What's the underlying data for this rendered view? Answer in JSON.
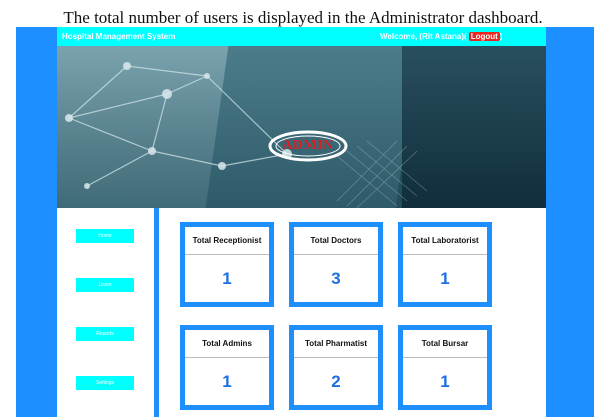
{
  "caption": "The total number of users is displayed in the Administrator dashboard.",
  "header": {
    "brand": "Hospital Management System",
    "welcome": "Welcome, (Rit Astana)(",
    "logout": "Logout",
    "welcome_end": ")"
  },
  "banner": {
    "logo_text": "ADMIN"
  },
  "sidebar": {
    "items": [
      {
        "label": "Home"
      },
      {
        "label": "Users"
      },
      {
        "label": "Reports"
      },
      {
        "label": "Settings"
      }
    ]
  },
  "dashboard": {
    "cards": [
      {
        "title": "Total Receptionist",
        "value": "1"
      },
      {
        "title": "Total Doctors",
        "value": "3"
      },
      {
        "title": "Total Laboratorist",
        "value": "1"
      },
      {
        "title": "Total Admins",
        "value": "1"
      },
      {
        "title": "Total Pharmatist",
        "value": "2"
      },
      {
        "title": "Total Bursar",
        "value": "1"
      }
    ]
  },
  "colors": {
    "frame": "#1e8fff",
    "topbar": "#00ffff",
    "logout": "#e6261f",
    "value": "#1e6fe0"
  }
}
